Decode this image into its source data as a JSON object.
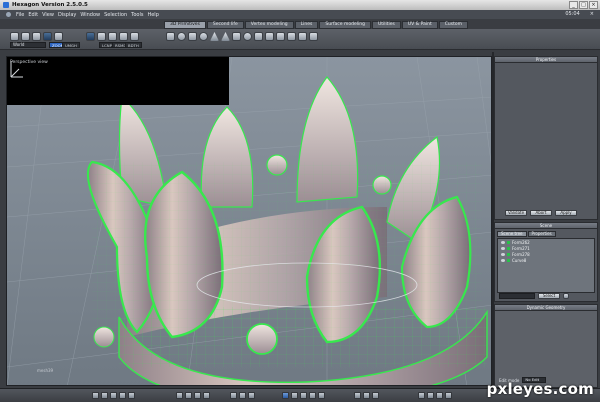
{
  "window": {
    "title": "Hexagon Version 2.5.0.5",
    "controls": [
      "_",
      "□",
      "×"
    ]
  },
  "menu": {
    "items": [
      "File",
      "Edit",
      "View",
      "Display",
      "Window",
      "Selection",
      "Tools",
      "Help"
    ]
  },
  "clock": {
    "time": "05:04"
  },
  "tabs": [
    "3D Primitives",
    "Second life",
    "Vertex modeling",
    "Lines",
    "Surface modeling",
    "Utilities",
    "UV & Paint",
    "Custom"
  ],
  "toolbar": {
    "coord_space": "World",
    "tags": [
      "ZOOM",
      "UMGH",
      "LCNP",
      "RSMD",
      "BDTH"
    ]
  },
  "viewport": {
    "label": "Perspective view",
    "axis_label": "mesh39"
  },
  "properties": {
    "title": "Properties",
    "buttons": [
      "Validate",
      "Abort",
      "Apply"
    ]
  },
  "scene": {
    "title": "Scene",
    "tabs": [
      "Scene tree",
      "Properties"
    ],
    "items": [
      "Form262",
      "Form271",
      "Form278",
      "Curve8"
    ],
    "select_button": "Select"
  },
  "dynamic_geometry": {
    "title": "Dynamic Geometry",
    "edit_label": "Edit mode",
    "edit_value": "No Edit"
  },
  "watermark": "pxleyes.com",
  "colors": {
    "wire": "#37e84d",
    "crown_light": "#d8c4bc",
    "crown_dark": "#7c6f78",
    "viewport_bg": "#7b858f"
  }
}
